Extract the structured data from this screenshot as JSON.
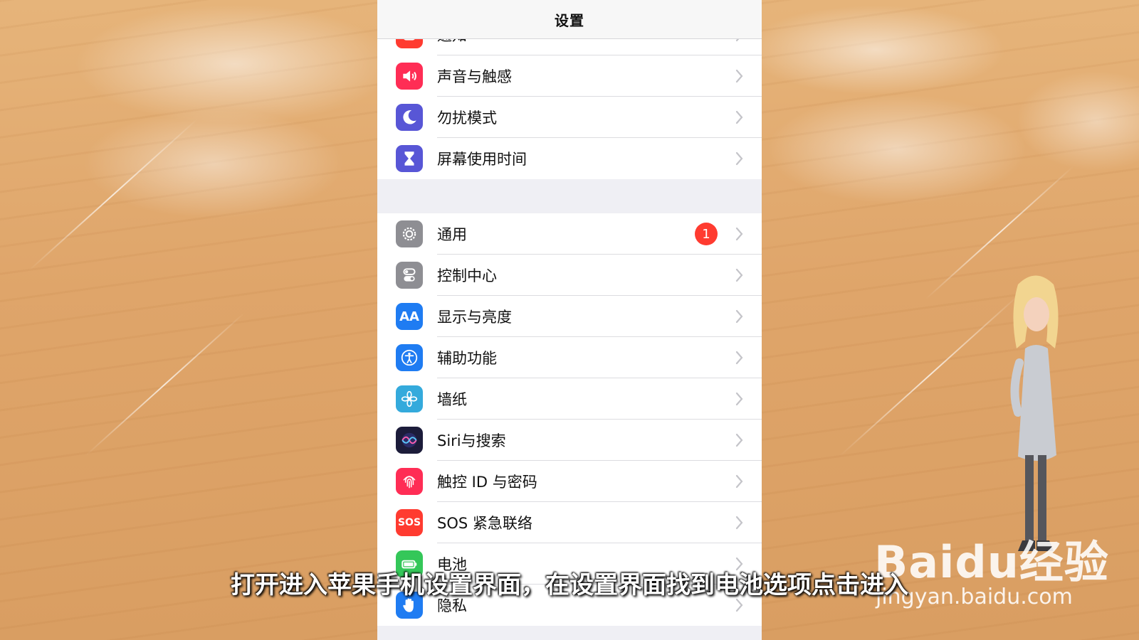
{
  "nav": {
    "title": "设置"
  },
  "group1": [
    {
      "id": "notifications",
      "label": "通知",
      "icon": "bell-icon",
      "color": "#ff3b30"
    },
    {
      "id": "sounds",
      "label": "声音与触感",
      "icon": "speaker-icon",
      "color": "#ff2d55"
    },
    {
      "id": "dnd",
      "label": "勿扰模式",
      "icon": "moon-icon",
      "color": "#5856d6"
    },
    {
      "id": "screen-time",
      "label": "屏幕使用时间",
      "icon": "hourglass-icon",
      "color": "#5856d6"
    }
  ],
  "group2": [
    {
      "id": "general",
      "label": "通用",
      "icon": "gear-icon",
      "color": "#8e8e93",
      "badge": "1"
    },
    {
      "id": "control-center",
      "label": "控制中心",
      "icon": "switches-icon",
      "color": "#8e8e93"
    },
    {
      "id": "display",
      "label": "显示与亮度",
      "icon": "text-size-icon",
      "color": "#1f7cf2",
      "glyph": "AA"
    },
    {
      "id": "accessibility",
      "label": "辅助功能",
      "icon": "accessibility-icon",
      "color": "#1f7cf2"
    },
    {
      "id": "wallpaper",
      "label": "墙纸",
      "icon": "flower-icon",
      "color": "#34aadc"
    },
    {
      "id": "siri",
      "label": "Siri与搜索",
      "icon": "siri-icon",
      "color": "#1c1c3a"
    },
    {
      "id": "touch-id",
      "label": "触控 ID 与密码",
      "icon": "fingerprint-icon",
      "color": "#ff2d55"
    },
    {
      "id": "sos",
      "label": "SOS 紧急联络",
      "icon": "sos-icon",
      "color": "#ff3b30",
      "glyph": "SOS"
    },
    {
      "id": "battery",
      "label": "电池",
      "icon": "battery-icon",
      "color": "#34c759"
    },
    {
      "id": "privacy",
      "label": "隐私",
      "icon": "hand-icon",
      "color": "#1f7cf2"
    }
  ],
  "caption": "打开进入苹果手机设置界面，在设置界面找到电池选项点击进入",
  "watermark": {
    "logo": "Baidu经验",
    "url": "jingyan.baidu.com"
  }
}
